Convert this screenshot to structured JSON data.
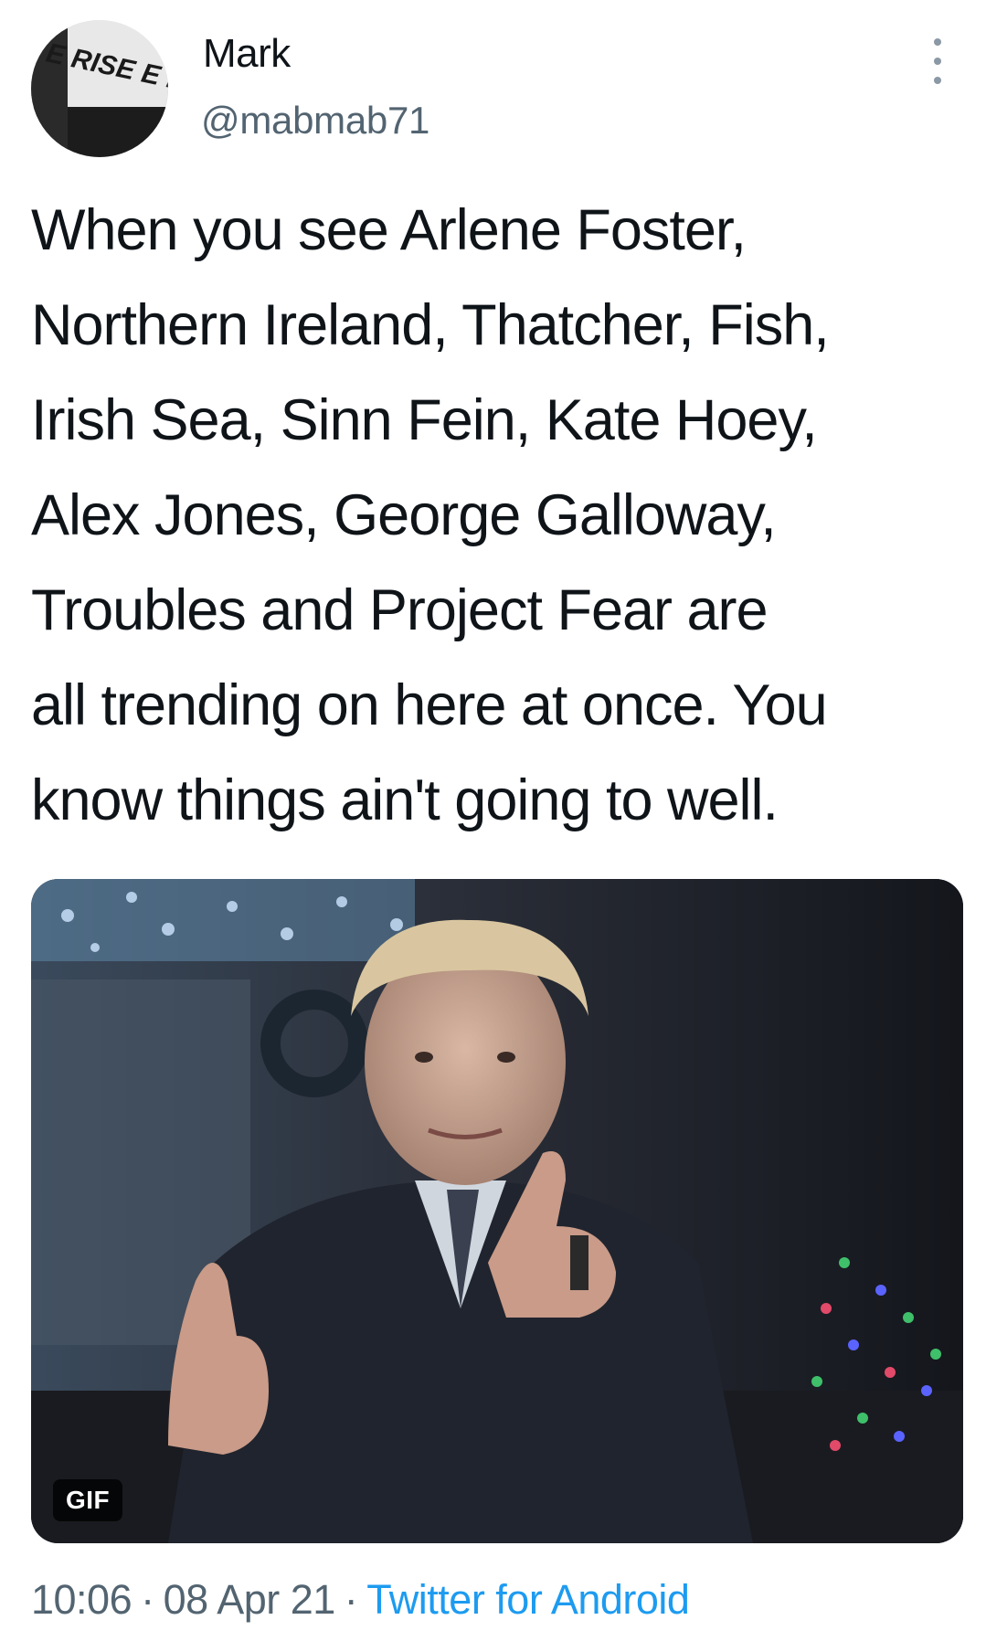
{
  "author": {
    "display_name": "Mark",
    "handle": "@mabmab71",
    "avatar_text": "E RISE E IDIOT"
  },
  "menu": {
    "icon": "more-vertical-icon"
  },
  "tweet": {
    "text": "When you see Arlene Foster,\nNorthern Ireland, Thatcher, Fish,\nIrish Sea, Sinn Fein, Kate Hoey,\nAlex Jones, George Galloway,\nTroubles and Project Fear are\nall trending on here at once. You\nknow things ain't going to well."
  },
  "media": {
    "badge": "GIF"
  },
  "meta": {
    "time": "10:06",
    "date": "08 Apr 21",
    "separator": "·",
    "source": "Twitter for Android"
  },
  "colors": {
    "text": "#0f1419",
    "secondary": "#536471",
    "link": "#1d9bf0"
  }
}
